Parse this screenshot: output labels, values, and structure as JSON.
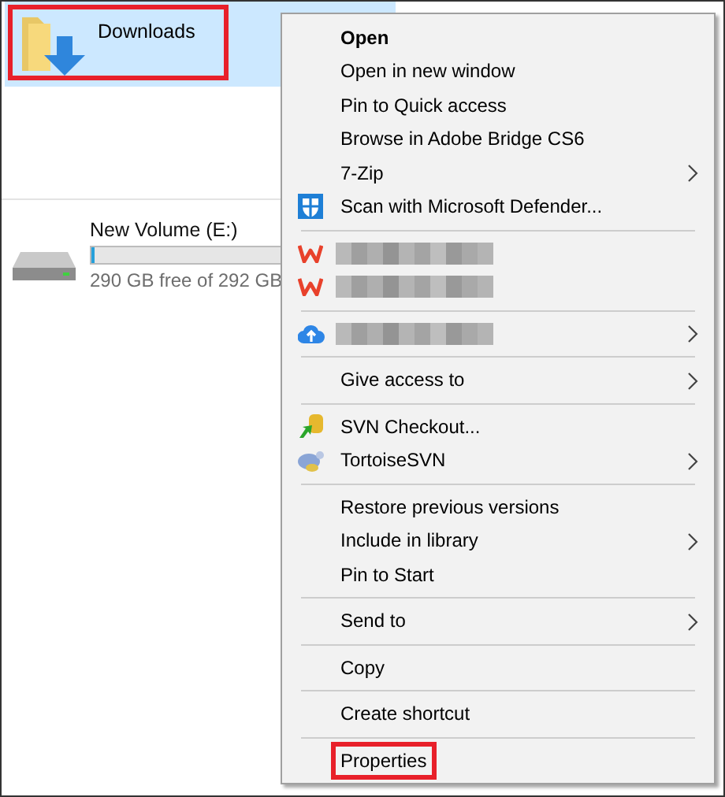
{
  "folder": {
    "name": "Downloads",
    "selected": true,
    "annotated": true
  },
  "drive": {
    "name": "New Volume (E:)",
    "level": 0.01,
    "free_text": "290 GB free of 292 GB"
  },
  "menu": {
    "groups": [
      [
        {
          "kind": "plain",
          "label": "Open",
          "bold": true,
          "submenu": false,
          "annotated": false
        },
        {
          "kind": "plain",
          "label": "Open in new window",
          "bold": false,
          "submenu": false,
          "annotated": false
        },
        {
          "kind": "plain",
          "label": "Pin to Quick access",
          "bold": false,
          "submenu": false,
          "annotated": false
        },
        {
          "kind": "plain",
          "label": "Browse in Adobe Bridge CS6",
          "bold": false,
          "submenu": false,
          "annotated": false
        },
        {
          "kind": "plain",
          "label": "7-Zip",
          "bold": false,
          "submenu": true,
          "annotated": false
        },
        {
          "kind": "shield",
          "label": "Scan with Microsoft Defender...",
          "bold": false,
          "submenu": false,
          "annotated": false
        }
      ],
      [
        {
          "kind": "wps",
          "submenu": false
        },
        {
          "kind": "wps",
          "submenu": false
        }
      ],
      [
        {
          "kind": "cloud",
          "submenu": true
        }
      ],
      [
        {
          "kind": "plain",
          "label": "Give access to",
          "bold": false,
          "submenu": true,
          "annotated": false
        }
      ],
      [
        {
          "kind": "svn",
          "label": "SVN Checkout...",
          "bold": false,
          "submenu": false,
          "annotated": false
        },
        {
          "kind": "tortoise",
          "label": "TortoiseSVN",
          "bold": false,
          "submenu": true,
          "annotated": false
        }
      ],
      [
        {
          "kind": "plain",
          "label": "Restore previous versions",
          "bold": false,
          "submenu": false,
          "annotated": false
        },
        {
          "kind": "plain",
          "label": "Include in library",
          "bold": false,
          "submenu": true,
          "annotated": false
        },
        {
          "kind": "plain",
          "label": "Pin to Start",
          "bold": false,
          "submenu": false,
          "annotated": false
        }
      ],
      [
        {
          "kind": "plain",
          "label": "Send to",
          "bold": false,
          "submenu": true,
          "annotated": false
        }
      ],
      [
        {
          "kind": "plain",
          "label": "Copy",
          "bold": false,
          "submenu": false,
          "annotated": false
        }
      ],
      [
        {
          "kind": "plain",
          "label": "Create shortcut",
          "bold": false,
          "submenu": false,
          "annotated": false
        }
      ],
      [
        {
          "kind": "plain",
          "label": "Properties",
          "bold": false,
          "submenu": false,
          "annotated": true
        }
      ]
    ]
  }
}
